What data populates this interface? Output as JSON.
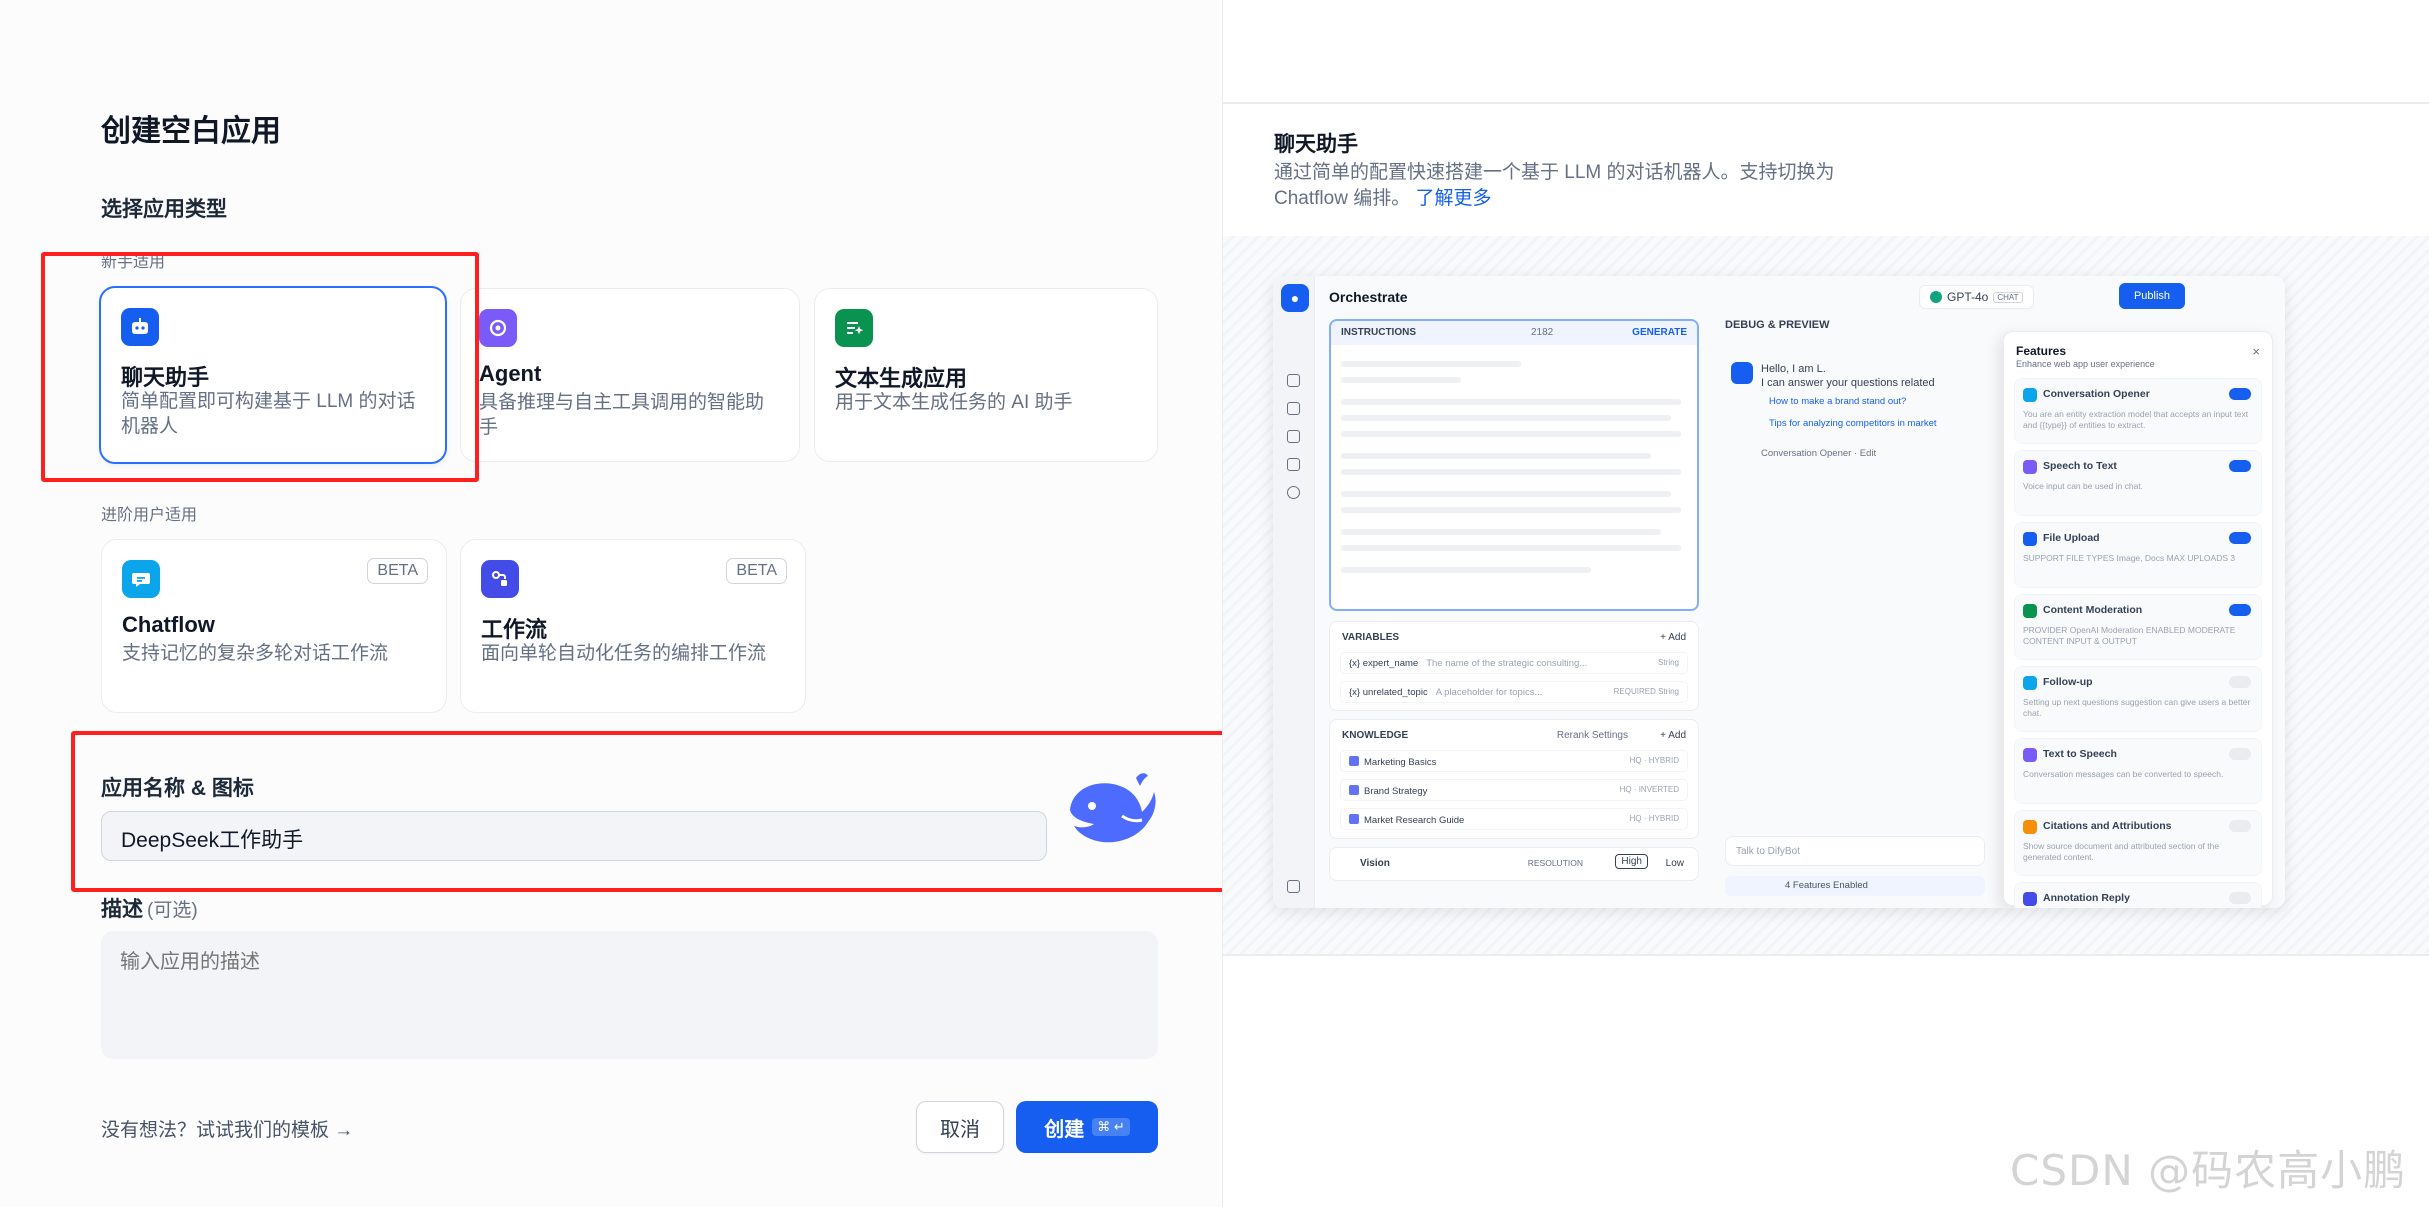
{
  "dialog": {
    "title": "创建空白应用",
    "type_section_label": "选择应用类型",
    "beginner_group_label": "新手适用",
    "advanced_group_label": "进阶用户适用",
    "app_types": [
      {
        "title": "聊天助手",
        "desc": "简单配置即可构建基于 LLM 的对话机器人",
        "selected": true,
        "color": "#155eef"
      },
      {
        "title": "Agent",
        "desc": "具备推理与自主工具调用的智能助手",
        "selected": false,
        "color": "#7a5af8"
      },
      {
        "title": "文本生成应用",
        "desc": "用于文本生成任务的 AI 助手",
        "selected": false,
        "color": "#099250"
      },
      {
        "title": "Chatflow",
        "desc": "支持记忆的复杂多轮对话工作流",
        "badge": "BETA",
        "selected": false,
        "color": "#0ba5ec"
      },
      {
        "title": "工作流",
        "desc": "面向单轮自动化任务的编排工作流",
        "badge": "BETA",
        "selected": false,
        "color": "#444ce7"
      }
    ],
    "name_section_label": "应用名称 & 图标",
    "name_value": "DeepSeek工作助手",
    "desc_label": "描述",
    "desc_optional": "(可选)",
    "desc_placeholder": "输入应用的描述",
    "template_link": "没有想法？试试我们的模板 →",
    "cancel_label": "取消",
    "create_label": "创建",
    "create_shortcut": "⌘ ↵"
  },
  "preview": {
    "title": "聊天助手",
    "desc": "通过简单的配置快速搭建一个基于 LLM 的对话机器人。支持切换为 Chatflow 编排。",
    "learn_more": "了解更多",
    "mock": {
      "orchestrate": "Orchestrate",
      "model": "GPT-4o",
      "model_chip": "CHAT",
      "publish": "Publish",
      "instructions": "INSTRUCTIONS",
      "instructions_count": "2182",
      "generate": "GENERATE",
      "variables": "VARIABLES",
      "add": "+ Add",
      "variable_rows": [
        {
          "name": "{x} expert_name",
          "hint": "The name of the strategic consulting...",
          "tag": "String"
        },
        {
          "name": "{x} unrelated_topic",
          "hint": "A placeholder for topics...",
          "tag": "REQUIRED  String"
        }
      ],
      "knowledge": "KNOWLEDGE",
      "rerank": "Rerank Settings",
      "knowledge_rows": [
        {
          "name": "Marketing Basics",
          "tag": "HQ · HYBRID"
        },
        {
          "name": "Brand Strategy",
          "tag": "HQ · INVERTED"
        },
        {
          "name": "Market Research Guide",
          "tag": "HQ · HYBRID"
        }
      ],
      "vision": "Vision",
      "resolution": "RESOLUTION",
      "high": "High",
      "low": "Low",
      "debug": "DEBUG & PREVIEW",
      "greeting_1": "Hello, I am L.",
      "greeting_2": "I can answer your questions related",
      "suggestion_1": "How to make a brand stand out?",
      "suggestion_2": "Tips for analyzing competitors in market",
      "opener": "Conversation Opener · Edit",
      "chat_placeholder": "Talk to DifyBot",
      "features_enabled": "4 Features Enabled",
      "features_title": "Features",
      "features_sub": "Enhance web app user experience",
      "features": [
        {
          "name": "Conversation Opener",
          "desc": "You are an entity extraction model that accepts an input text and {{type}} of entities to extract.",
          "on": true,
          "color": "#0ba5ec"
        },
        {
          "name": "Speech to Text",
          "desc": "Voice input can be used in chat.",
          "on": true,
          "color": "#7a5af8"
        },
        {
          "name": "File Upload",
          "desc": "SUPPORT FILE TYPES  Image, Docs      MAX UPLOADS  3",
          "on": true,
          "color": "#155eef"
        },
        {
          "name": "Content Moderation",
          "desc": "PROVIDER  OpenAI Moderation      ENABLED MODERATE CONTENT  INPUT & OUTPUT",
          "on": true,
          "color": "#099250"
        },
        {
          "name": "Follow-up",
          "desc": "Setting up next questions suggestion can give users a better chat.",
          "on": false,
          "color": "#0ba5ec"
        },
        {
          "name": "Text to Speech",
          "desc": "Conversation messages can be converted to speech.",
          "on": false,
          "color": "#7a5af8"
        },
        {
          "name": "Citations and Attributions",
          "desc": "Show source document and attributed section of the generated content.",
          "on": false,
          "color": "#f79009"
        },
        {
          "name": "Annotation Reply",
          "desc": "",
          "on": false,
          "color": "#444ce7"
        }
      ]
    }
  },
  "watermark": "CSDN @码农高小鹏"
}
